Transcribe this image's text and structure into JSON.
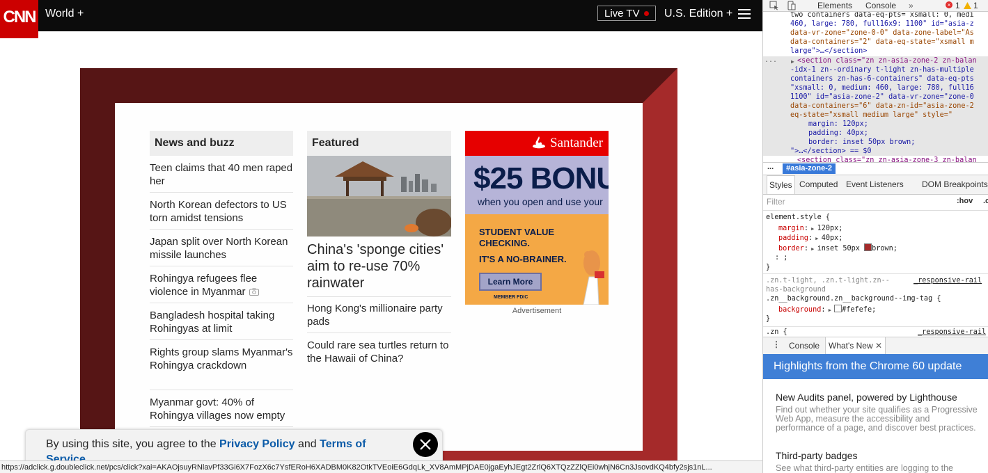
{
  "cnn": {
    "logo": "CNN",
    "nav_world": "World +",
    "live_tv": "Live TV",
    "edition": "U.S. Edition +"
  },
  "news": {
    "header": "News and buzz",
    "items": [
      "Teen claims that 40 men raped her",
      "North Korean defectors to US torn amidst tensions",
      "Japan split over North Korean missile launches",
      "Rohingya refugees flee violence in Myanmar",
      "Bangladesh hospital taking Rohingyas at limit",
      "Rights group slams Myanmar's Rohingya crackdown",
      "Myanmar govt: 40% of Rohingya villages now empty"
    ]
  },
  "featured": {
    "header": "Featured",
    "headline": "China's 'sponge cities' aim to re-use 70% rainwater",
    "items": [
      "Hong Kong's millionaire party pads",
      "Could rare sea turtles return to the Hawaii of China?"
    ]
  },
  "ad": {
    "brand": "Santander",
    "bonus": "$25 BONUS",
    "when": "when you open and use your",
    "student": "STUDENT VALUE CHECKING.",
    "brainer": "IT'S A NO-BRAINER.",
    "learn_more": "Learn More",
    "fdic": "MEMBER FDIC",
    "label": "Advertisement"
  },
  "cookie": {
    "text_before": "By using this site, you agree to the ",
    "privacy": "Privacy Policy",
    "and": " and ",
    "terms": "Terms of Service",
    "period": "."
  },
  "statusbar": "https://adclick.g.doubleclick.net/pcs/click?xai=AKAOjsuyRNlavPf33Gi6X7FozX6c7YsfERoH6XADBM0K82OtkTVEoiE6GdqLk_XV8AmMPjDAE0jgaEyhJEgt2ZrlQ6XTQzZZlQEi0whjN6Cn3JsovdKQ4bfy2sjs1nL...",
  "devtools": {
    "tabs": [
      "Elements",
      "Console"
    ],
    "more": "»",
    "errors": "1",
    "warnings": "1",
    "dom_lines": [
      "two containers  data-eq-pts= xsmall: 0, medi",
      "460, large: 780, full16x9: 1100\" id=\"asia-z",
      "data-vr-zone=\"zone-0-0\" data-zone-label=\"As",
      "data-containers=\"2\" data-eq-state=\"xsmall m",
      "large\">…</section>",
      "<section class=\"zn zn-asia-zone-2 zn-balan",
      "-idx-1 zn--ordinary t-light zn-has-multiple",
      "containers zn-has-6-containers\" data-eq-pts",
      "\"xsmall: 0, medium: 460, large: 780, full16",
      "1100\" id=\"asia-zone-2\" data-vr-zone=\"zone-0",
      "data-containers=\"6\" data-zn-id=\"asia-zone-2",
      "eq-state=\"xsmall medium large\" style=\"",
      "margin: 120px;",
      "padding: 40px;",
      "border: inset 50px brown;",
      "\">…</section> == $0",
      "<section class=\"zn zn-asia-zone-3 zn-balan"
    ],
    "ellipsis": "...",
    "crumb": "#asia-zone-2",
    "subtabs": [
      "Styles",
      "Computed",
      "Event Listeners",
      "DOM Breakpoints"
    ],
    "filter": "Filter",
    "hov": ":hov",
    "cls": ".c",
    "styles": {
      "element_style": "element.style {",
      "margin_prop": "margin",
      "margin_val": "120px;",
      "padding_prop": "padding",
      "padding_val": "40px;",
      "border_prop": "border",
      "border_val_a": "inset 50px",
      "border_val_b": "brown;",
      "cursor_line": ": ;",
      "close": "}",
      "rule_selector_1": ".zn.t-light, .zn.t-light.zn--",
      "rule_selector_2": "has-background",
      "rule_selector_3": ".zn__background.zn__background--img-tag {",
      "rule_source": "_responsive-rail",
      "bg_prop": "background",
      "bg_val": "#fefefe;",
      "close2": "}",
      "next_rule": ".zn {",
      "next_source": "_responsive-rail"
    },
    "drawer_tabs": [
      "Console",
      "What's New"
    ],
    "banner": "Highlights from the Chrome 60 update",
    "whatsnew": [
      {
        "title": "New Audits panel, powered by Lighthouse",
        "desc": "Find out whether your site qualifies as a Progressive Web App, measure the accessibility and performance of a page, and discover best practices."
      },
      {
        "title": "Third-party badges",
        "desc": "See what third-party entities are logging to the"
      }
    ]
  },
  "colors": {
    "cnn_red": "#cc0000",
    "zone_border_dark": "#561515",
    "zone_border_light": "#a52a2a",
    "link_blue": "#0b5ba8",
    "devtools_blue": "#3f7fd6"
  }
}
